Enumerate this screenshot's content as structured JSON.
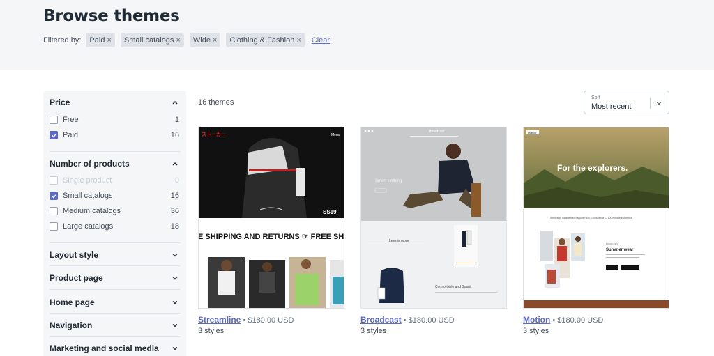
{
  "page": {
    "title": "Browse themes"
  },
  "filters": {
    "label": "Filtered by:",
    "chips": [
      "Paid",
      "Small catalogs",
      "Wide",
      "Clothing & Fashion"
    ],
    "clear_label": "Clear"
  },
  "sidebar": {
    "price": {
      "title": "Price",
      "options": [
        {
          "label": "Free",
          "count": "1",
          "checked": false
        },
        {
          "label": "Paid",
          "count": "16",
          "checked": true
        }
      ]
    },
    "products": {
      "title": "Number of products",
      "options": [
        {
          "label": "Single product",
          "count": "0",
          "checked": false,
          "disabled": true
        },
        {
          "label": "Small catalogs",
          "count": "16",
          "checked": true
        },
        {
          "label": "Medium catalogs",
          "count": "36",
          "checked": false
        },
        {
          "label": "Large catalogs",
          "count": "18",
          "checked": false
        }
      ]
    },
    "collapsed": [
      "Layout style",
      "Product page",
      "Home page",
      "Navigation",
      "Marketing and social media"
    ]
  },
  "results": {
    "count_text": "16 themes",
    "sort_label": "Sort",
    "sort_value": "Most recent"
  },
  "themes": [
    {
      "name": "Streamline",
      "price": "$180.00 USD",
      "styles": "3 styles",
      "preview": {
        "logo": "ストーカー",
        "nav": "Menu",
        "badge": "SS19",
        "banner": "E SHIPPING AND RETURNS ☞ FREE SH"
      }
    },
    {
      "name": "Broadcast",
      "price": "$180.00 USD",
      "styles": "3 styles",
      "preview": {
        "logo": "Broadcast",
        "hero": "Smart clothing",
        "tile1": "Less is more",
        "tile2": "Comfortable and Smart"
      }
    },
    {
      "name": "Motion",
      "price": "$180.00 USD",
      "styles": "3 styles",
      "preview": {
        "logo": "motion",
        "hero": "For the explorers.",
        "sub": "We design durable travel apparel with a conscience — 100% made in America",
        "eyebrow": "BRAND NEW",
        "section": "Summer wear"
      }
    }
  ],
  "colors": {
    "accent": "#5c6ac4",
    "header_bg": "#f4f6f8",
    "sidebar_bg": "#f4f6f8"
  },
  "separator": "•"
}
